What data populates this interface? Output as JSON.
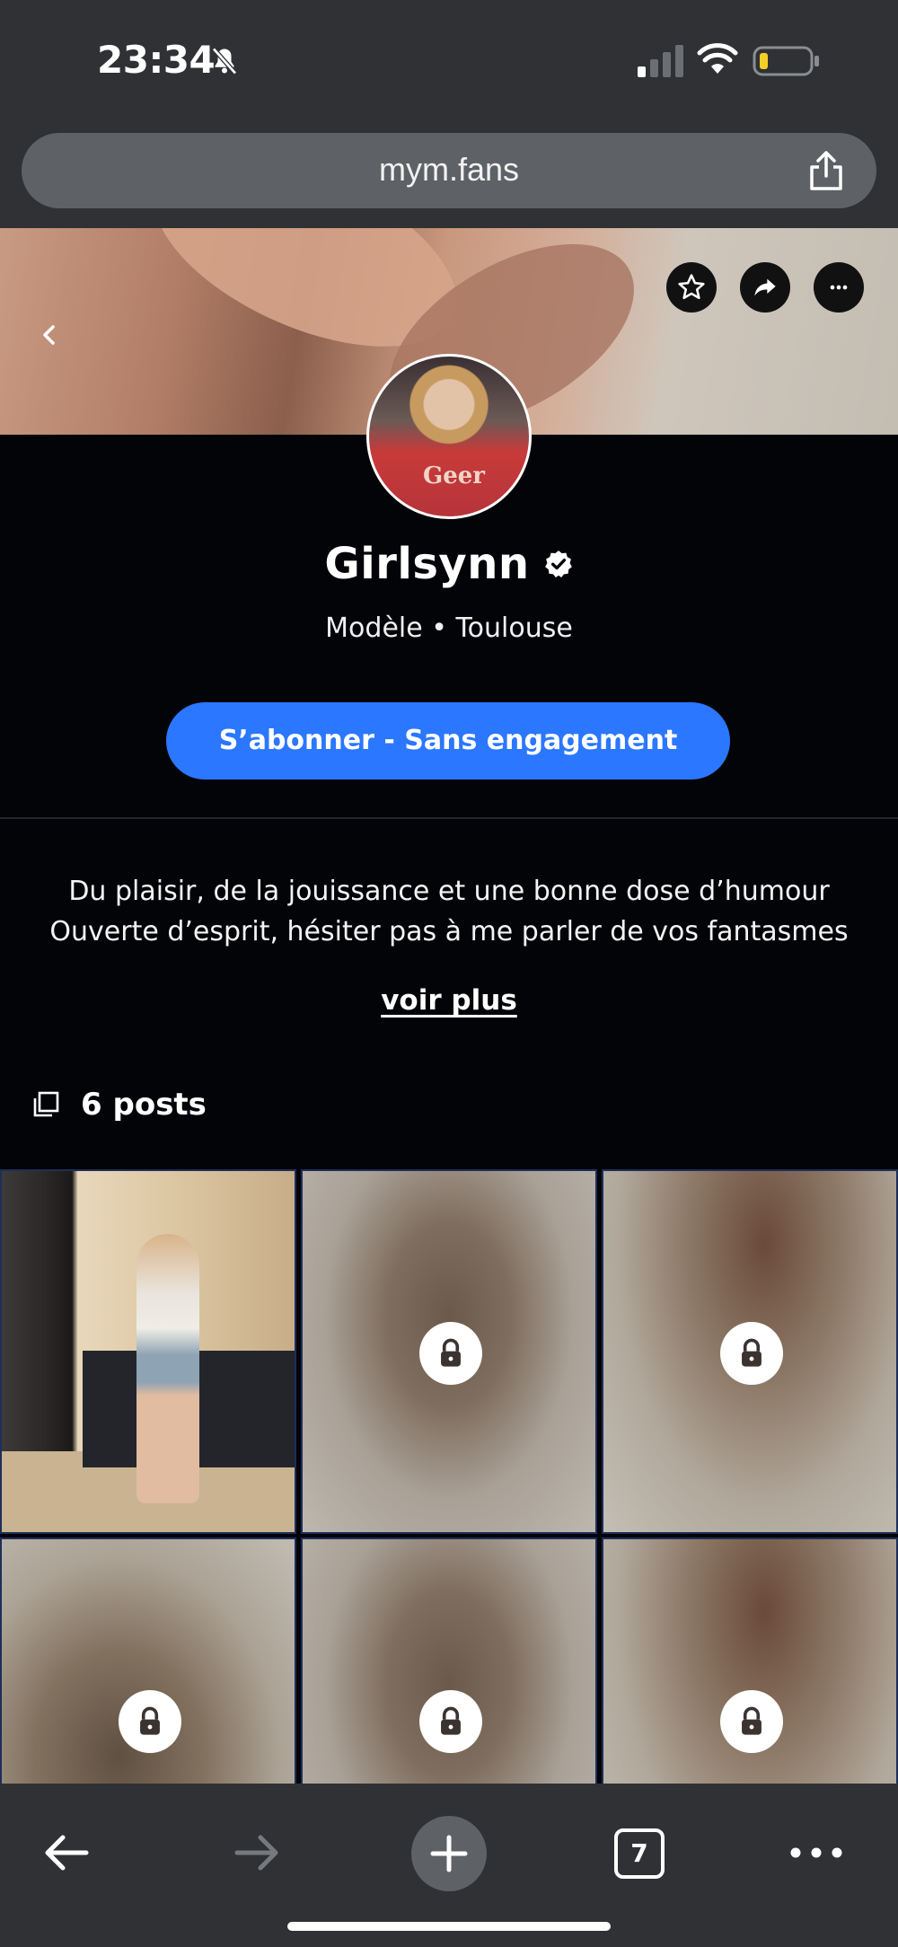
{
  "status_bar": {
    "time": "23:34",
    "icons": [
      "bell-slash-icon",
      "cellular-signal-icon",
      "wifi-icon",
      "battery-low-icon"
    ]
  },
  "browser": {
    "url": "mym.fans",
    "tab_count": "7",
    "icons": [
      "share-icon",
      "back-arrow-icon",
      "forward-arrow-icon",
      "new-tab-plus-icon",
      "tabs-icon",
      "more-dots-icon"
    ]
  },
  "profile": {
    "name": "Girlsynn",
    "subtitle": "Modèle • Toulouse",
    "avatar_shirt_text": "Geer",
    "subscribe_label": "S’abonner - Sans engagement",
    "bio_line1": "Du plaisir, de la jouissance et une bonne dose d’humour",
    "bio_line2": "Ouverte d’esprit, hésiter pas à me parler de vos fantasmes",
    "see_more": "voir plus",
    "posts_count": "6 posts",
    "header_icons": [
      "back-chevron-icon",
      "star-icon",
      "share-arrow-icon",
      "more-horizontal-icon",
      "verified-badge-icon"
    ]
  },
  "posts": [
    {
      "locked": false
    },
    {
      "locked": true
    },
    {
      "locked": true
    },
    {
      "locked": true
    },
    {
      "locked": true
    },
    {
      "locked": true
    }
  ],
  "colors": {
    "accent": "#2b77ff",
    "background": "#030408",
    "browser_chrome": "#2f3134"
  }
}
